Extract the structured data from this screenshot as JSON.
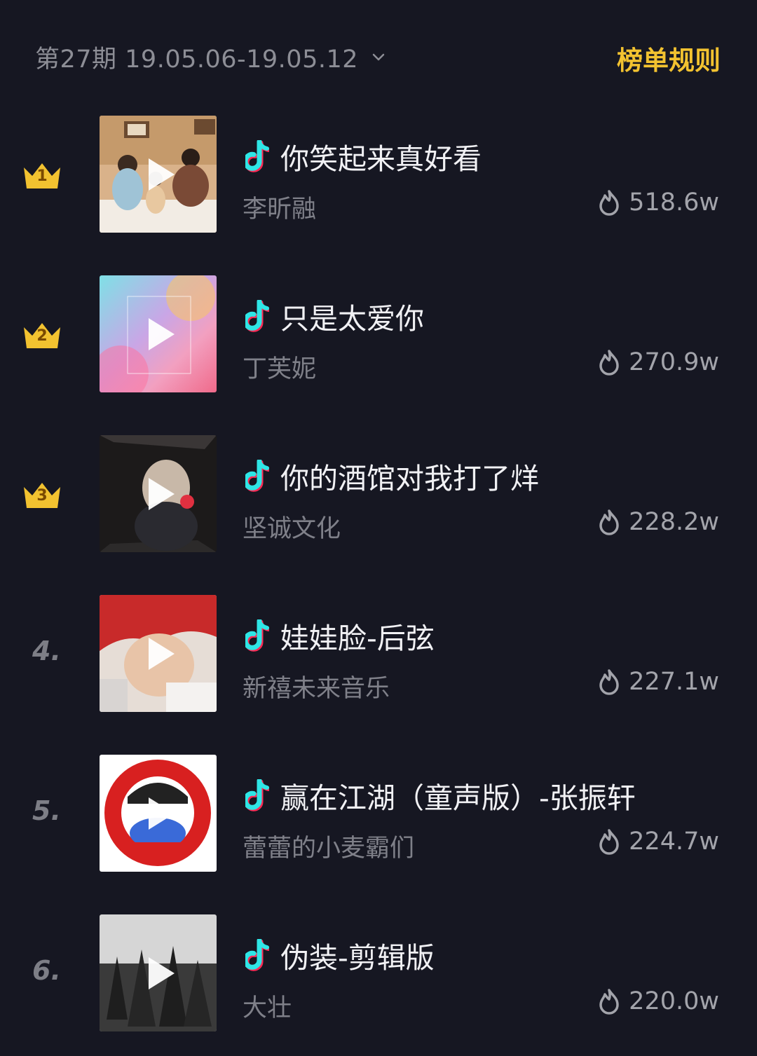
{
  "header": {
    "period": "第27期 19.05.06-19.05.12",
    "rules_link": "榜单规则"
  },
  "icons": {
    "crown_color": "#f2c230",
    "note_color": "#2ee6e6",
    "accent_red": "#ff2a55"
  },
  "songs": [
    {
      "rank": "1",
      "title": "你笑起来真好看",
      "artist": "李昕融",
      "heat": "518.6w",
      "badge": "crown"
    },
    {
      "rank": "2",
      "title": "只是太爱你",
      "artist": "丁芙妮",
      "heat": "270.9w",
      "badge": "crown"
    },
    {
      "rank": "3",
      "title": "你的酒馆对我打了烊",
      "artist": "坚诚文化",
      "heat": "228.2w",
      "badge": "crown"
    },
    {
      "rank": "4.",
      "title": "娃娃脸-后弦",
      "artist": "新禧未来音乐",
      "heat": "227.1w",
      "badge": "number"
    },
    {
      "rank": "5.",
      "title": "赢在江湖（童声版）-张振轩",
      "artist": "蕾蕾的小麦霸们",
      "heat": "224.7w",
      "badge": "number"
    },
    {
      "rank": "6.",
      "title": "伪装-剪辑版",
      "artist": "大壮",
      "heat": "220.0w",
      "badge": "number"
    }
  ]
}
